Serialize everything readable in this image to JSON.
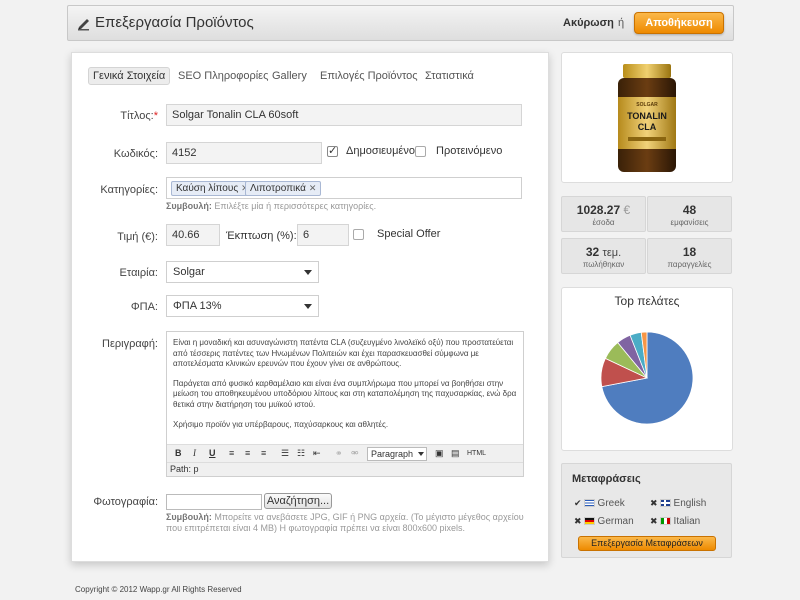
{
  "header": {
    "title": "Επεξεργασία Προϊόντος",
    "cancel_label": "Ακύρωση",
    "or_label": "ή",
    "save_label": "Αποθήκευση"
  },
  "tabs": [
    {
      "label": "Γενικά Στοιχεία",
      "active": true
    },
    {
      "label": "SEO Πληροφορίες"
    },
    {
      "label": "Gallery"
    },
    {
      "label": "Επιλογές Προϊόντος"
    },
    {
      "label": "Στατιστικά"
    }
  ],
  "form": {
    "title_label": "Τίτλος:",
    "required_mark": "*",
    "title_value": "Solgar Tonalin CLA 60soft",
    "code_label": "Κωδικός:",
    "code_value": "4152",
    "published_label": "Δημοσιευμένο",
    "published_checked": true,
    "featured_label": "Προτεινόμενο",
    "featured_checked": false,
    "categories_label": "Κατηγορίες:",
    "categories": [
      "Καύση λίπους",
      "Λιποτροπικά"
    ],
    "categories_hint_bold": "Συμβουλή:",
    "categories_hint": "Επιλέξτε μία ή περισσότερες κατηγορίες.",
    "price_label": "Τιμή (€):",
    "price_value": "40.66",
    "discount_label": "Έκπτωση (%):",
    "discount_value": "6",
    "special_offer_label": "Special Offer",
    "special_offer_checked": false,
    "company_label": "Εταιρία:",
    "company_value": "Solgar",
    "vat_label": "ΦΠΑ:",
    "vat_value": "ΦΠΑ 13%",
    "description_label": "Περιγραφή:",
    "description_paragraphs": [
      "Είναι η μοναδική και ασυναγώνιστη πατέντα CLA (συζευγμένο λινολεϊκό οξύ) που προστατεύεται από τέσσερις πατέντες των Ηνωμένων Πολιτειών και έχει παρασκευασθεί σύμφωνα με αποτελέσματα κλινικών ερευνών που έχουν γίνει σε ανθρώπους.",
      "Παράγεται από φυσικό καρθαμέλαιο και είναι ένα συμπλήρωμα που μπορεί να βοηθήσει στην μείωση του αποθηκευμένου υποδόριου λίπους και στη καταπολέμηση της παχυσαρκίας, ενώ δρα θετικά στην διατήρηση του μυϊκού ιστού.",
      "Χρήσιμο προϊόν για υπέρβαρους, παχύσαρκους και αθλητές."
    ],
    "editor_format": "Paragraph",
    "editor_path": "Path: p",
    "photo_label": "Φωτογραφία:",
    "browse_label": "Αναζήτηση...",
    "photo_hint_bold": "Συμβουλή:",
    "photo_hint_line1": "Μπορείτε να ανεβάσετε JPG, GIF ή PNG αρχεία. (Το μέγιστο μέγεθος αρχείου",
    "photo_hint_line2": "που επιτρέπεται είναι 4 MB) Η φωτογραφία πρέπει να είναι 800x600 pixels."
  },
  "product_image": {
    "brand": "SOLGAR",
    "name_line1": "TONALIN",
    "name_line2": "CLA"
  },
  "stats": [
    {
      "value": "1028.27",
      "unit": "€",
      "label": "έσοδα"
    },
    {
      "value": "48",
      "unit": "",
      "label": "εμφανίσεις"
    },
    {
      "value": "32",
      "unit": "τεμ.",
      "label": "πωλήθηκαν"
    },
    {
      "value": "18",
      "unit": "",
      "label": "παραγγελίες"
    }
  ],
  "top_customers": {
    "title": "Top πελάτες",
    "chart_data": {
      "type": "pie",
      "values": [
        72,
        10,
        7,
        5,
        4,
        2
      ],
      "colors": [
        "#4f7dbf",
        "#c0504d",
        "#9bbb59",
        "#8064a2",
        "#4bacc6",
        "#f79646"
      ]
    }
  },
  "translations": {
    "title": "Μεταφράσεις",
    "languages": [
      {
        "name": "Greek",
        "done": true,
        "flag": "greek"
      },
      {
        "name": "English",
        "done": false,
        "flag": "english"
      },
      {
        "name": "German",
        "done": false,
        "flag": "german"
      },
      {
        "name": "Italian",
        "done": false,
        "flag": "italian"
      }
    ],
    "button_label": "Επεξεργασία Μεταφράσεων"
  },
  "footer": "Copyright © 2012 Wapp.gr All Rights Reserved"
}
